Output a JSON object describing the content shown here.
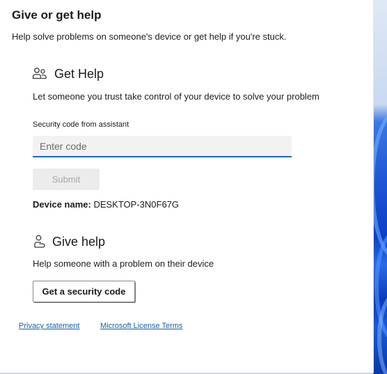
{
  "header": {
    "title": "Give or get help",
    "subtitle": "Help solve problems on someone's device or get help if you're stuck."
  },
  "get_help": {
    "icon": "people-icon",
    "heading": "Get Help",
    "description": "Let someone you trust take control of your device to solve your problem",
    "field_label": "Security code from assistant",
    "input_value": "",
    "input_placeholder": "Enter code",
    "submit_label": "Submit",
    "device_name_label": "Device name:",
    "device_name_value": "DESKTOP-3N0F67G"
  },
  "give_help": {
    "icon": "person-assist-icon",
    "heading": "Give help",
    "description": "Help someone with a problem on their device",
    "button_label": "Get a security code"
  },
  "footer": {
    "privacy_label": "Privacy statement",
    "license_label": "Microsoft License Terms"
  },
  "colors": {
    "accent": "#1b64c4",
    "link": "#1a5ea8",
    "disabled_text": "#a7a7a7",
    "window_background": "#ffffff"
  }
}
